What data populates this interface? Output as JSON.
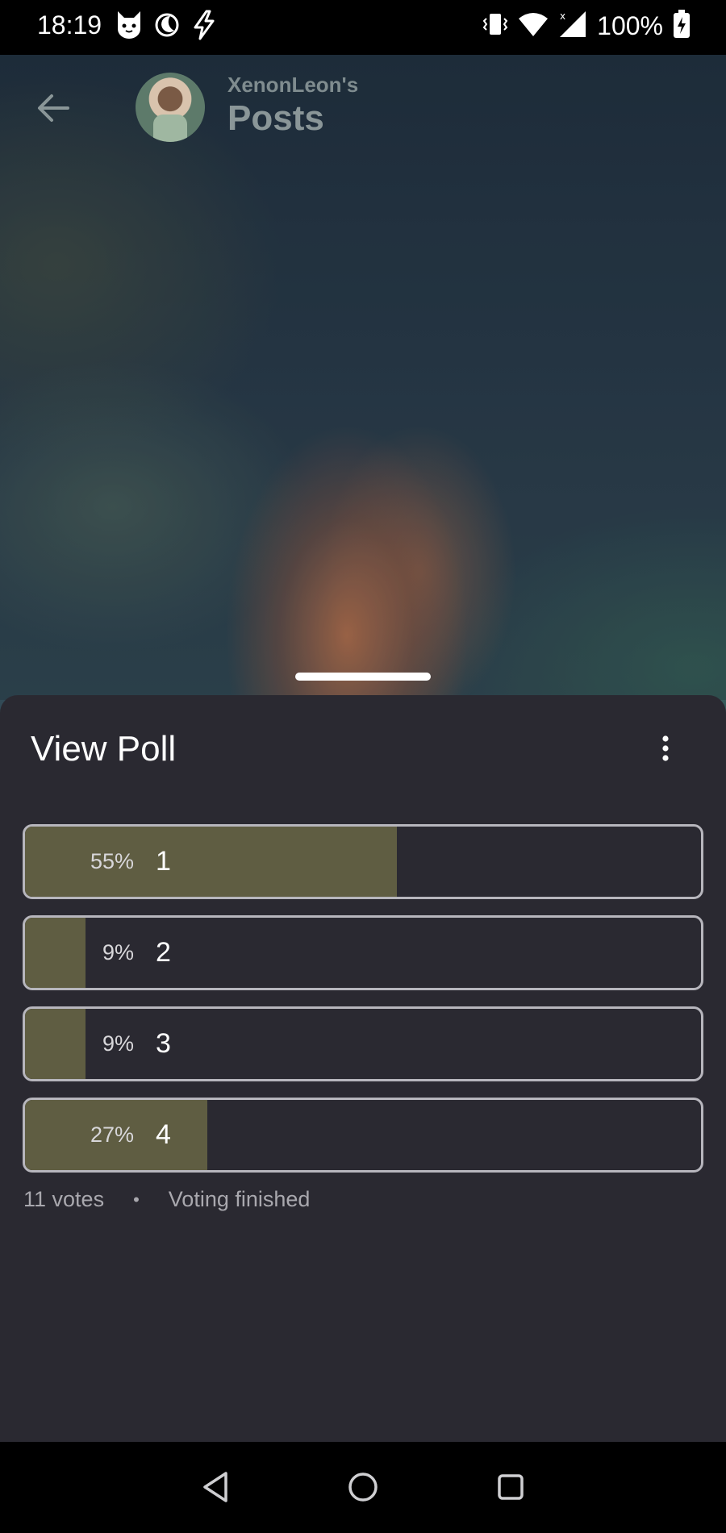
{
  "status_bar": {
    "time": "18:19",
    "battery": "100%",
    "icons": [
      "cat-notification-icon",
      "moon-icon",
      "bolt-icon",
      "vibrate-icon",
      "wifi-icon",
      "signal-icon",
      "battery-charging-icon"
    ]
  },
  "header": {
    "subtitle": "XenonLeon's",
    "title": "Posts",
    "back_icon": "arrow-left-icon"
  },
  "poll": {
    "title": "View Poll",
    "menu_icon": "more-vertical-icon",
    "options": [
      {
        "percent": "55%",
        "label": "1",
        "fraction": 0.55
      },
      {
        "percent": "9%",
        "label": "2",
        "fraction": 0.09
      },
      {
        "percent": "9%",
        "label": "3",
        "fraction": 0.09
      },
      {
        "percent": "27%",
        "label": "4",
        "fraction": 0.27
      }
    ],
    "votes": "11 votes",
    "separator": "•",
    "status": "Voting finished"
  },
  "colors": {
    "sheet_bg": "#2a2931",
    "bar_fill": "#5f5d42",
    "bar_border": "#b7b6bd"
  },
  "nav": {
    "back_icon": "nav-back-icon",
    "home_icon": "nav-home-icon",
    "recents_icon": "nav-recents-icon"
  }
}
